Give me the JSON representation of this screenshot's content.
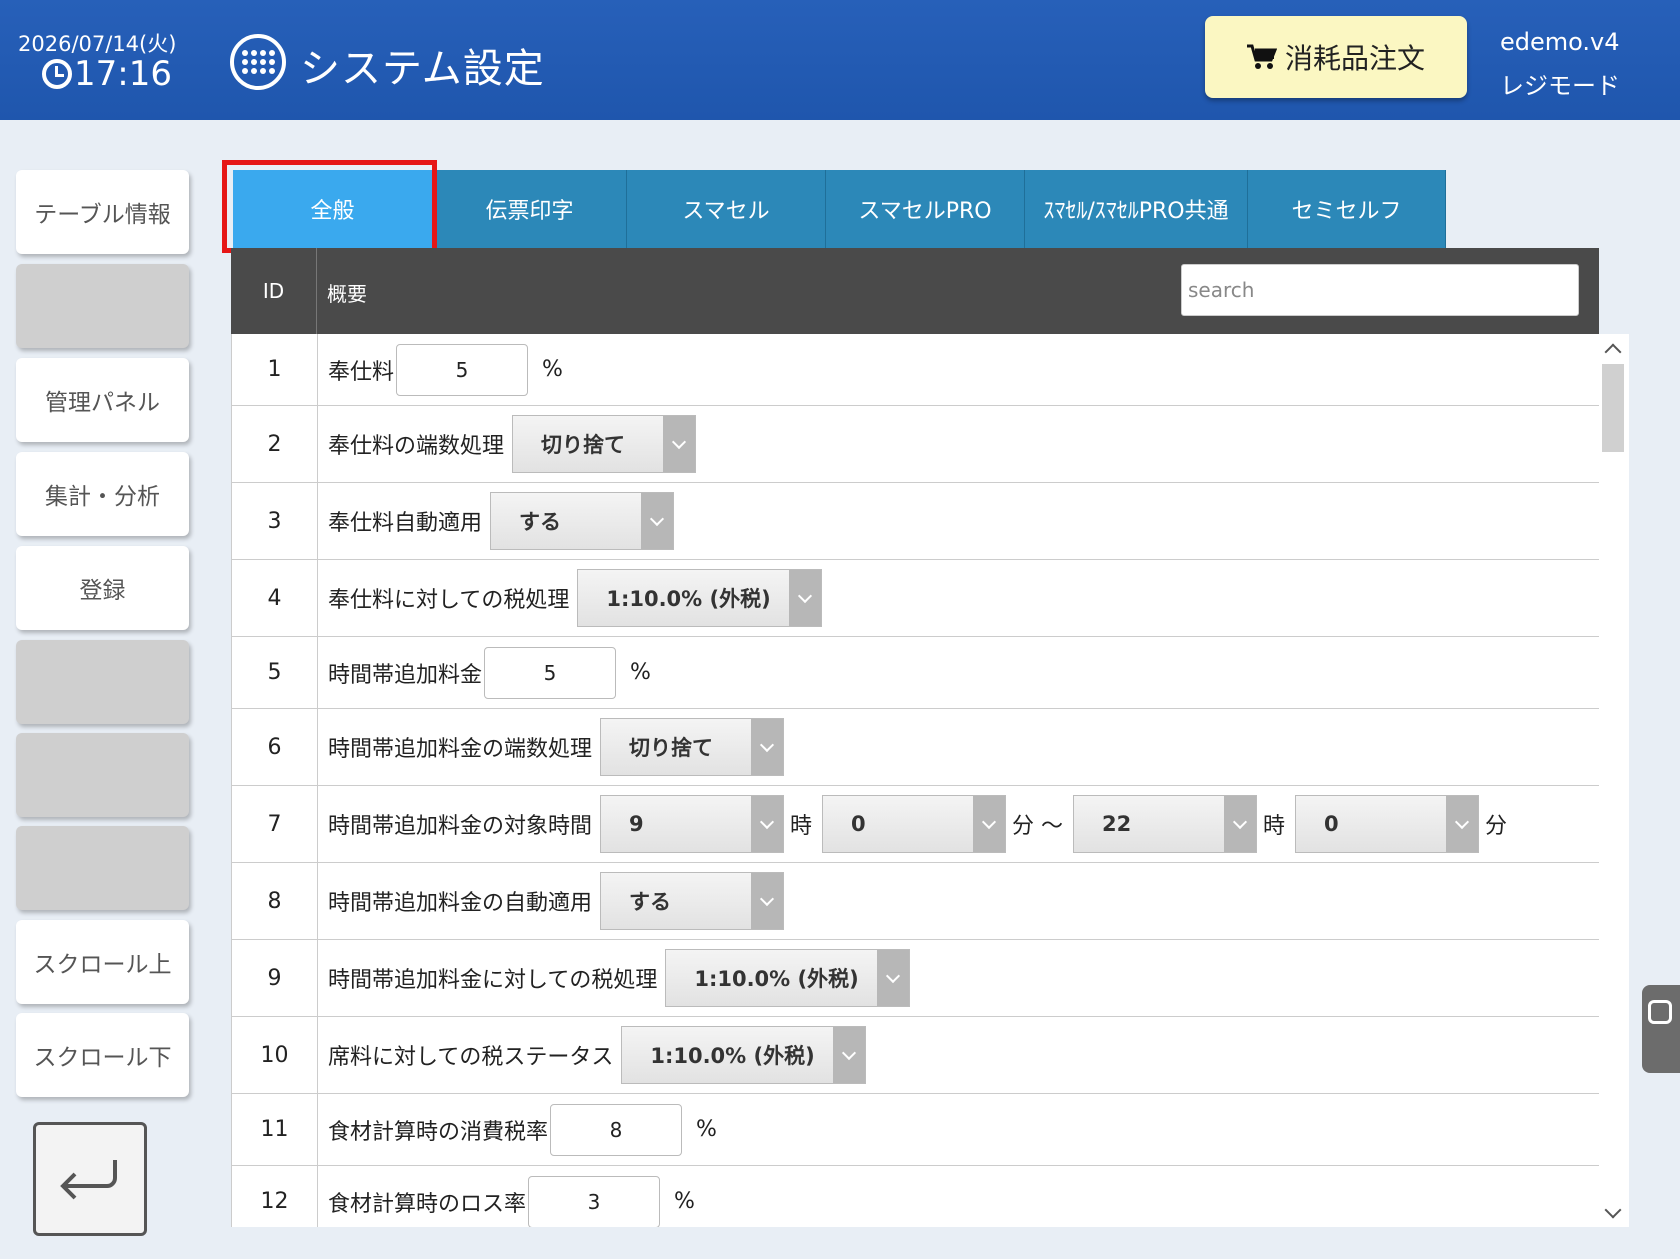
{
  "header": {
    "date": "2026/07/14(火)",
    "time": "17:16",
    "title": "システム設定",
    "order_button": "消耗品注文",
    "user": "edemo.v4",
    "mode": "レジモード"
  },
  "sidebar": {
    "items": [
      {
        "label": "テーブル情報"
      },
      {
        "label": ""
      },
      {
        "label": "管理パネル"
      },
      {
        "label": "集計・分析"
      },
      {
        "label": "登録"
      },
      {
        "label": ""
      },
      {
        "label": ""
      },
      {
        "label": ""
      },
      {
        "label": "スクロール上"
      },
      {
        "label": "スクロール下"
      }
    ]
  },
  "tabs": [
    "全般",
    "伝票印字",
    "スマセル",
    "スマセルPRO",
    "ｽﾏｾﾙ/ｽﾏｾﾙPRO共通",
    "セミセルフ"
  ],
  "table": {
    "col_id": "ID",
    "col_summary": "概要",
    "search_placeholder": "search"
  },
  "rows": [
    {
      "id": "1",
      "label": "奉仕料",
      "input": "5",
      "unit": "%"
    },
    {
      "id": "2",
      "label": "奉仕料の端数処理",
      "select": "切り捨て"
    },
    {
      "id": "3",
      "label": "奉仕料自動適用",
      "select": "する"
    },
    {
      "id": "4",
      "label": "奉仕料に対しての税処理",
      "select": "1:10.0% (外税)"
    },
    {
      "id": "5",
      "label": "時間帯追加料金",
      "input": "5",
      "unit": "%"
    },
    {
      "id": "6",
      "label": "時間帯追加料金の端数処理",
      "select": "切り捨て"
    },
    {
      "id": "7",
      "label": "時間帯追加料金の対象時間",
      "from_hour": "9",
      "from_min": "0",
      "to_hour": "22",
      "to_min": "0",
      "u_hour": "時",
      "u_min_tilde": "分 ～",
      "u_hour2": "時",
      "u_min2": "分"
    },
    {
      "id": "8",
      "label": "時間帯追加料金の自動適用",
      "select": "する"
    },
    {
      "id": "9",
      "label": "時間帯追加料金に対しての税処理",
      "select": "1:10.0% (外税)"
    },
    {
      "id": "10",
      "label": "席料に対しての税ステータス",
      "select": "1:10.0% (外税)"
    },
    {
      "id": "11",
      "label": "食材計算時の消費税率",
      "input": "8",
      "unit": "%"
    },
    {
      "id": "12",
      "label": "食材計算時のロス率",
      "input": "3",
      "unit": "%"
    }
  ]
}
